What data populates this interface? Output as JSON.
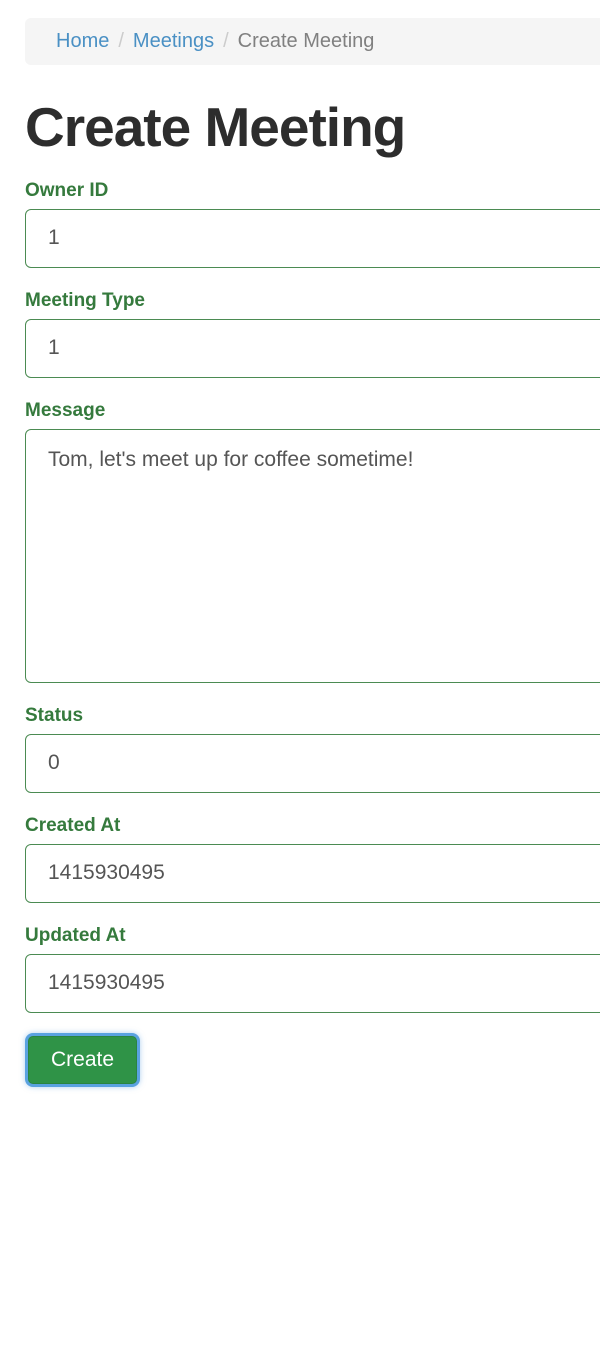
{
  "breadcrumb": {
    "items": [
      {
        "label": "Home",
        "type": "link"
      },
      {
        "label": "Meetings",
        "type": "link"
      },
      {
        "label": "Create Meeting",
        "type": "active"
      }
    ],
    "separator": "/"
  },
  "page": {
    "title": "Create Meeting"
  },
  "form": {
    "fields": [
      {
        "label": "Owner ID",
        "value": "1",
        "control": "input"
      },
      {
        "label": "Meeting Type",
        "value": "1",
        "control": "input"
      },
      {
        "label": "Message",
        "value": "Tom, let's meet up for coffee sometime!",
        "control": "textarea"
      },
      {
        "label": "Status",
        "value": "0",
        "control": "input"
      },
      {
        "label": "Created At",
        "value": "1415930495",
        "control": "input"
      },
      {
        "label": "Updated At",
        "value": "1415930495",
        "control": "input"
      }
    ],
    "submit_label": "Create"
  },
  "colors": {
    "label_green": "#357a3d",
    "border_green": "#4b8b52",
    "button_green": "#2f9347",
    "link_blue": "#4a90c4",
    "breadcrumb_bg": "#f5f5f5",
    "focus_blue": "#5aa2e0"
  }
}
